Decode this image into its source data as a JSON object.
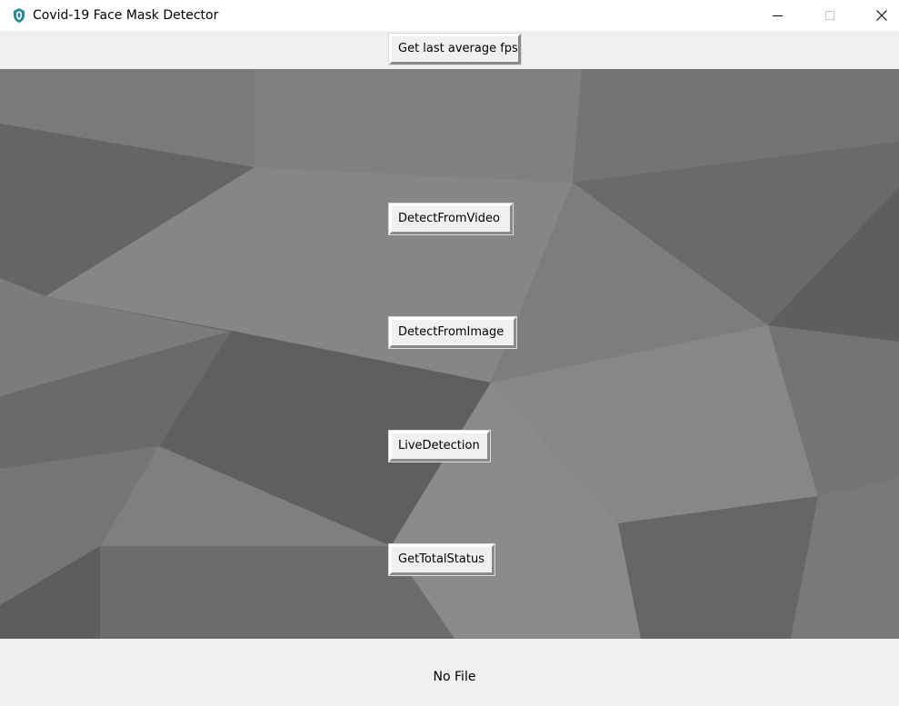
{
  "window": {
    "title": "Covid-19 Face Mask Detector",
    "controls": {
      "minimize": "minimize-icon",
      "maximize": "maximize-icon",
      "close": "close-icon"
    }
  },
  "toolbar": {
    "fps_label": "Get last average fps"
  },
  "main": {
    "background": "gray-low-poly-pattern",
    "buttons": [
      {
        "label": "DetectFromVideo"
      },
      {
        "label": "DetectFromImage"
      },
      {
        "label": "LiveDetection"
      },
      {
        "label": "GetTotalStatus"
      }
    ]
  },
  "status": {
    "text": "No File"
  },
  "colors": {
    "canvas_base": "#6e6e6e",
    "chrome": "#f0f0f0",
    "app_icon": "#2a8a93"
  }
}
